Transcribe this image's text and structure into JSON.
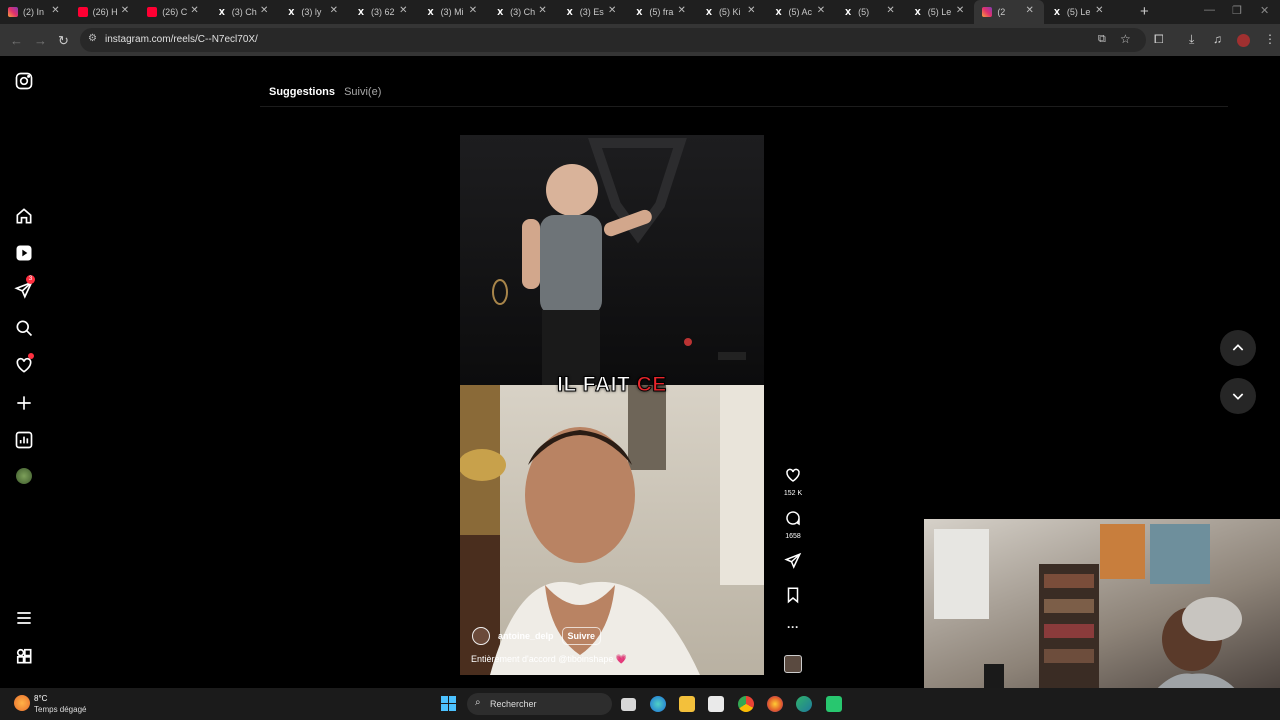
{
  "browser": {
    "tabs": [
      {
        "icon": "instagram-icon",
        "title": "(2) In"
      },
      {
        "icon": "youtube-icon",
        "title": "(26) H"
      },
      {
        "icon": "youtube-icon",
        "title": "(26) C"
      },
      {
        "icon": "x-icon",
        "title": "(3) Ch"
      },
      {
        "icon": "x-icon",
        "title": "(3) ly"
      },
      {
        "icon": "x-icon",
        "title": "(3) 62"
      },
      {
        "icon": "x-icon",
        "title": "(3) Mi"
      },
      {
        "icon": "x-icon",
        "title": "(3) Ch"
      },
      {
        "icon": "x-icon",
        "title": "(3) Es"
      },
      {
        "icon": "x-icon",
        "title": "(5) fra"
      },
      {
        "icon": "x-icon",
        "title": "(5) Ki"
      },
      {
        "icon": "x-icon",
        "title": "(5) Ac"
      },
      {
        "icon": "x-icon",
        "title": "(5)"
      },
      {
        "icon": "x-icon",
        "title": "(5) Le"
      },
      {
        "icon": "instagram-icon",
        "title": "(2"
      },
      {
        "icon": "x-icon",
        "title": "(5) Le"
      }
    ],
    "active_tab_index": 14,
    "url": "instagram.com/reels/C--N7ecl70X/"
  },
  "instagram": {
    "feed_tabs": {
      "suggestions": "Suggestions",
      "following": "Suivi(e)"
    },
    "notifications_badge": "3",
    "reel": {
      "caption_overlay_word1": "IL FAIT",
      "caption_overlay_word2": "CE",
      "author": "antoine_delp",
      "follow_label": "Suivre",
      "caption": "Entièrement d'accord @tiboinshape 💗"
    },
    "actions": {
      "likes": "152 K",
      "comments": "1658"
    }
  },
  "taskbar": {
    "weather_temp": "8°C",
    "weather_desc": "Temps dégagé",
    "search_placeholder": "Rechercher"
  },
  "colors": {
    "instagram_badge": "#ff3040",
    "caption_highlight": "#e8252b",
    "windows_accent": "#4cc2ff"
  }
}
